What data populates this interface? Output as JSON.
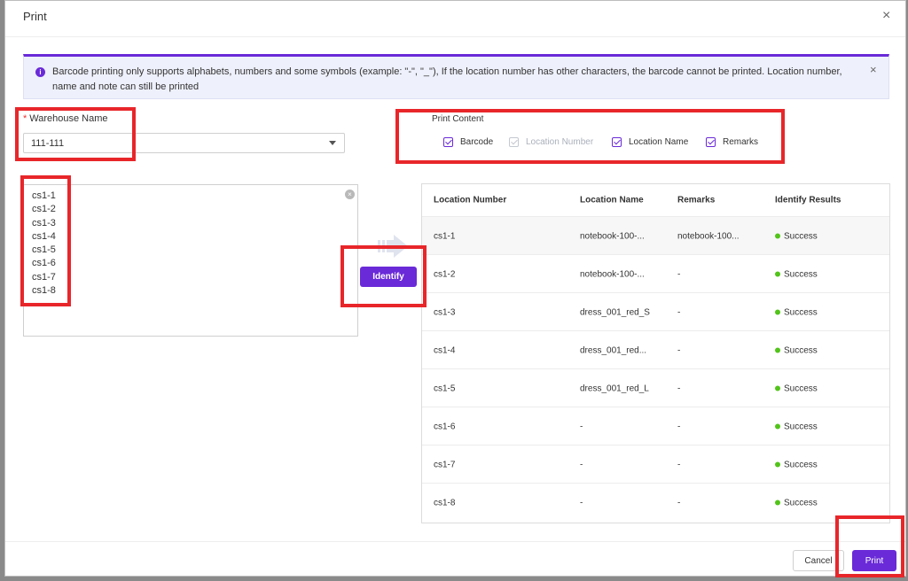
{
  "dialog": {
    "title": "Print",
    "close_glyph": "×"
  },
  "notice": {
    "icon": "info-icon",
    "text": "Barcode printing only supports alphabets, numbers and some symbols (example: \"-\", \"_\"), If the location number has other characters, the barcode cannot be printed. Location number, name and note can still be printed",
    "close_glyph": "×"
  },
  "warehouse": {
    "required_mark": "*",
    "label": "Warehouse Name",
    "value": "111-111"
  },
  "print_content": {
    "label": "Print Content",
    "options": [
      {
        "label": "Barcode",
        "checked": true,
        "disabled": false
      },
      {
        "label": "Location Number",
        "checked": true,
        "disabled": true
      },
      {
        "label": "Location Name",
        "checked": true,
        "disabled": false
      },
      {
        "label": "Remarks",
        "checked": true,
        "disabled": false
      }
    ]
  },
  "input_list": [
    "cs1-1",
    "cs1-2",
    "cs1-3",
    "cs1-4",
    "cs1-5",
    "cs1-6",
    "cs1-7",
    "cs1-8"
  ],
  "identify_button": "Identify",
  "table": {
    "headers": [
      "Location Number",
      "Location Name",
      "Remarks",
      "Identify Results"
    ],
    "rows": [
      {
        "number": "cs1-1",
        "name": "notebook-100-...",
        "remarks": "notebook-100...",
        "result": "Success"
      },
      {
        "number": "cs1-2",
        "name": "notebook-100-...",
        "remarks": "-",
        "result": "Success"
      },
      {
        "number": "cs1-3",
        "name": "dress_001_red_S",
        "remarks": "-",
        "result": "Success"
      },
      {
        "number": "cs1-4",
        "name": "dress_001_red...",
        "remarks": "-",
        "result": "Success"
      },
      {
        "number": "cs1-5",
        "name": "dress_001_red_L",
        "remarks": "-",
        "result": "Success"
      },
      {
        "number": "cs1-6",
        "name": "-",
        "remarks": "-",
        "result": "Success"
      },
      {
        "number": "cs1-7",
        "name": "-",
        "remarks": "-",
        "result": "Success"
      },
      {
        "number": "cs1-8",
        "name": "-",
        "remarks": "-",
        "result": "Success"
      }
    ]
  },
  "footer": {
    "cancel": "Cancel",
    "print": "Print"
  },
  "colors": {
    "accent": "#6a2ad8",
    "success": "#52c41a",
    "highlight": "#e8262a"
  }
}
